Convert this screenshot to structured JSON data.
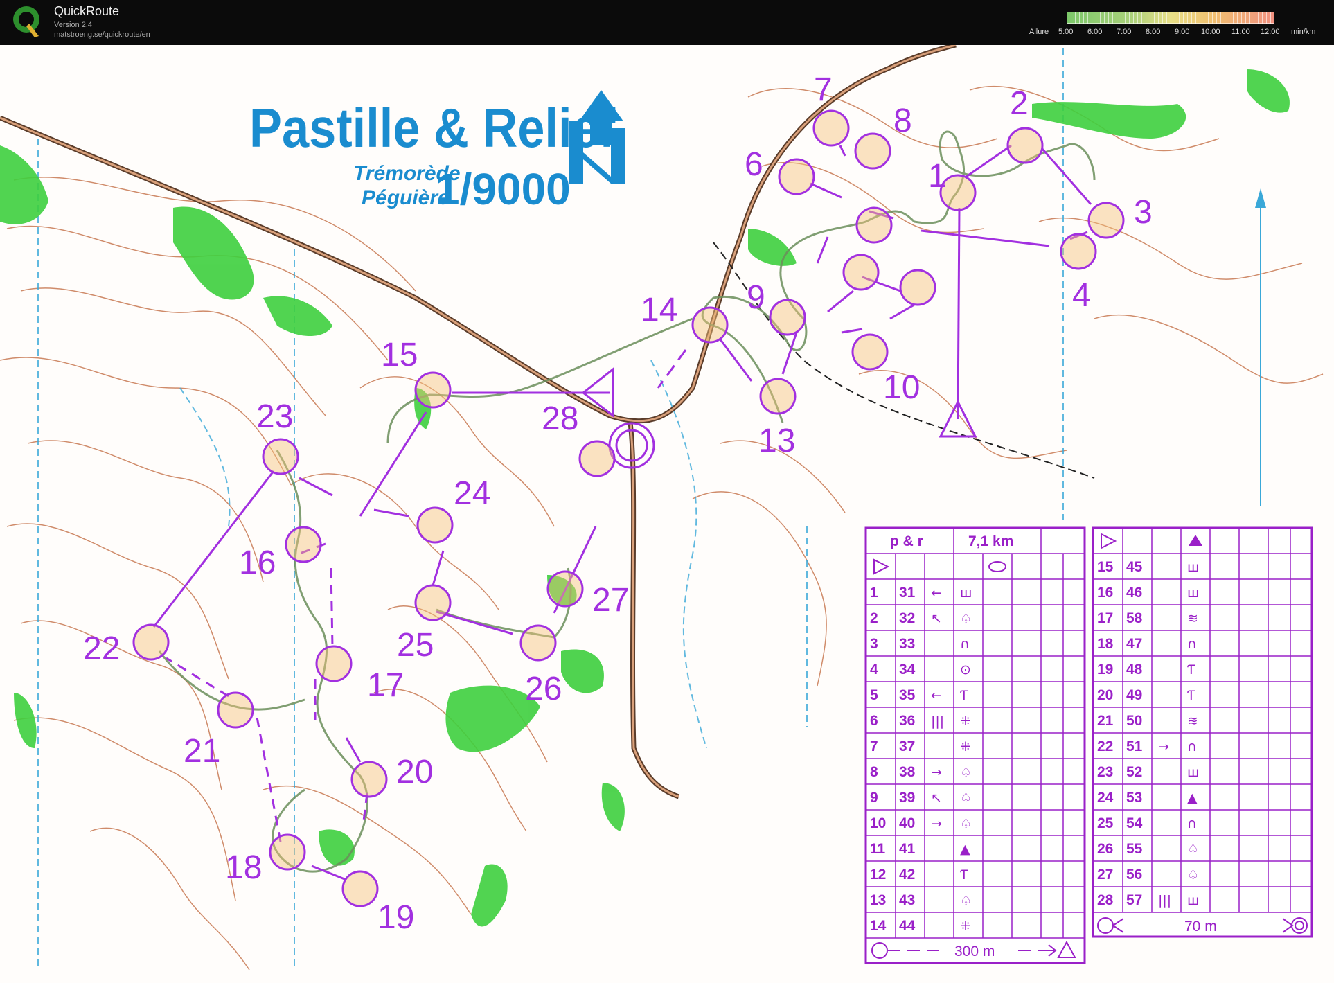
{
  "app": {
    "name": "QuickRoute",
    "version": "Version 2.4",
    "url": "matstroeng.se/quickroute/en"
  },
  "pace_scale": {
    "label": "Allure",
    "ticks": [
      "5:00",
      "6:00",
      "7:00",
      "8:00",
      "9:00",
      "10:00",
      "11:00",
      "12:00"
    ],
    "unit": "min/km"
  },
  "map": {
    "title": "Pastille & Relief",
    "location_line1": "Trémorède",
    "location_line2": "Péguière",
    "scale": "1/9000",
    "colors": {
      "course": "#a230e0",
      "route": "#6b8e5a",
      "contour": "#b5542a",
      "vegetation": "#3ecf3e",
      "water": "#3aa8d8",
      "title": "#1a8ccf"
    },
    "control_labels": [
      "1",
      "2",
      "3",
      "4",
      "6",
      "7",
      "8",
      "9",
      "10",
      "13",
      "14",
      "15",
      "16",
      "17",
      "18",
      "19",
      "20",
      "21",
      "22",
      "23",
      "24",
      "25",
      "26",
      "27",
      "28"
    ]
  },
  "description_table_left": {
    "header_name": "p & r",
    "header_length": "7,1 km",
    "rows": [
      {
        "n": "1",
        "code": "31",
        "c": "←",
        "d": "ш"
      },
      {
        "n": "2",
        "code": "32",
        "c": "↖",
        "d": "♤"
      },
      {
        "n": "3",
        "code": "33",
        "c": "",
        "d": "∩"
      },
      {
        "n": "4",
        "code": "34",
        "c": "",
        "d": "⊙"
      },
      {
        "n": "5",
        "code": "35",
        "c": "←",
        "d": "Ƭ"
      },
      {
        "n": "6",
        "code": "36",
        "c": "|||",
        "d": "⁜"
      },
      {
        "n": "7",
        "code": "37",
        "c": "",
        "d": "⁜"
      },
      {
        "n": "8",
        "code": "38",
        "c": "→",
        "d": "♤"
      },
      {
        "n": "9",
        "code": "39",
        "c": "↖",
        "d": "♤"
      },
      {
        "n": "10",
        "code": "40",
        "c": "→",
        "d": "♤"
      },
      {
        "n": "11",
        "code": "41",
        "c": "",
        "d": "▲"
      },
      {
        "n": "12",
        "code": "42",
        "c": "",
        "d": "Ƭ"
      },
      {
        "n": "13",
        "code": "43",
        "c": "",
        "d": "♤"
      },
      {
        "n": "14",
        "code": "44",
        "c": "",
        "d": "⁜"
      }
    ],
    "footer": "300 m"
  },
  "description_table_right": {
    "rows": [
      {
        "n": "15",
        "code": "45",
        "c": "",
        "d": "ш"
      },
      {
        "n": "16",
        "code": "46",
        "c": "",
        "d": "ш"
      },
      {
        "n": "17",
        "code": "58",
        "c": "",
        "d": "≋"
      },
      {
        "n": "18",
        "code": "47",
        "c": "",
        "d": "∩"
      },
      {
        "n": "19",
        "code": "48",
        "c": "",
        "d": "Ƭ"
      },
      {
        "n": "20",
        "code": "49",
        "c": "",
        "d": "Ƭ"
      },
      {
        "n": "21",
        "code": "50",
        "c": "",
        "d": "≋"
      },
      {
        "n": "22",
        "code": "51",
        "c": "→",
        "d": "∩"
      },
      {
        "n": "23",
        "code": "52",
        "c": "",
        "d": "ш"
      },
      {
        "n": "24",
        "code": "53",
        "c": "",
        "d": "▲"
      },
      {
        "n": "25",
        "code": "54",
        "c": "",
        "d": "∩"
      },
      {
        "n": "26",
        "code": "55",
        "c": "",
        "d": "♤"
      },
      {
        "n": "27",
        "code": "56",
        "c": "",
        "d": "♤"
      },
      {
        "n": "28",
        "code": "57",
        "c": "|||",
        "d": "ш"
      }
    ],
    "footer": "70 m"
  }
}
